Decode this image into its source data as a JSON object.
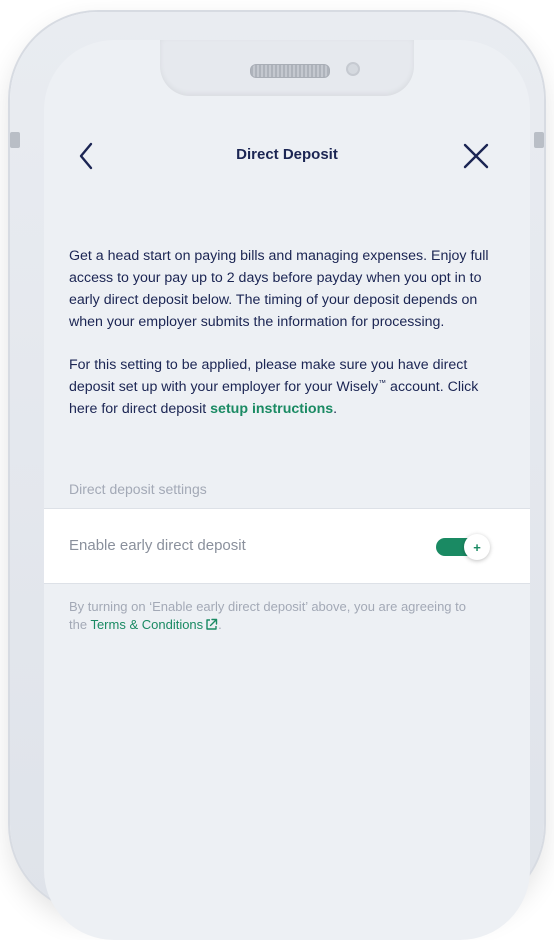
{
  "header": {
    "title": "Direct Deposit"
  },
  "content": {
    "paragraph1": "Get a head start on paying bills and managing expenses. Enjoy full access to your pay up to 2 days before payday when you opt in to early direct deposit below. The timing of your deposit depends on when your employer submits the information for processing.",
    "paragraph2_part1": "For this setting to be applied, please make sure you have direct deposit set up with your employer for your Wisely",
    "paragraph2_tm": "™",
    "paragraph2_part2": " account. Click here for direct deposit ",
    "setup_link": "setup instructions",
    "paragraph2_end": "."
  },
  "settings": {
    "section_label": "Direct deposit settings",
    "early_deposit_label": "Enable early direct deposit",
    "early_deposit_enabled": true,
    "toggle_symbol": "+"
  },
  "footnote": {
    "text_before": "By turning on ‘Enable early direct deposit’ above, you are agreeing to the ",
    "terms_link": "Terms & Conditions",
    "text_after": "."
  },
  "colors": {
    "accent": "#1a8a63",
    "text_primary": "#1b2553",
    "text_muted": "#a3a9b6",
    "screen_background": "#edf0f4"
  },
  "icons": {
    "back": "chevron-left-icon",
    "close": "close-icon",
    "external_link": "external-link-icon"
  }
}
